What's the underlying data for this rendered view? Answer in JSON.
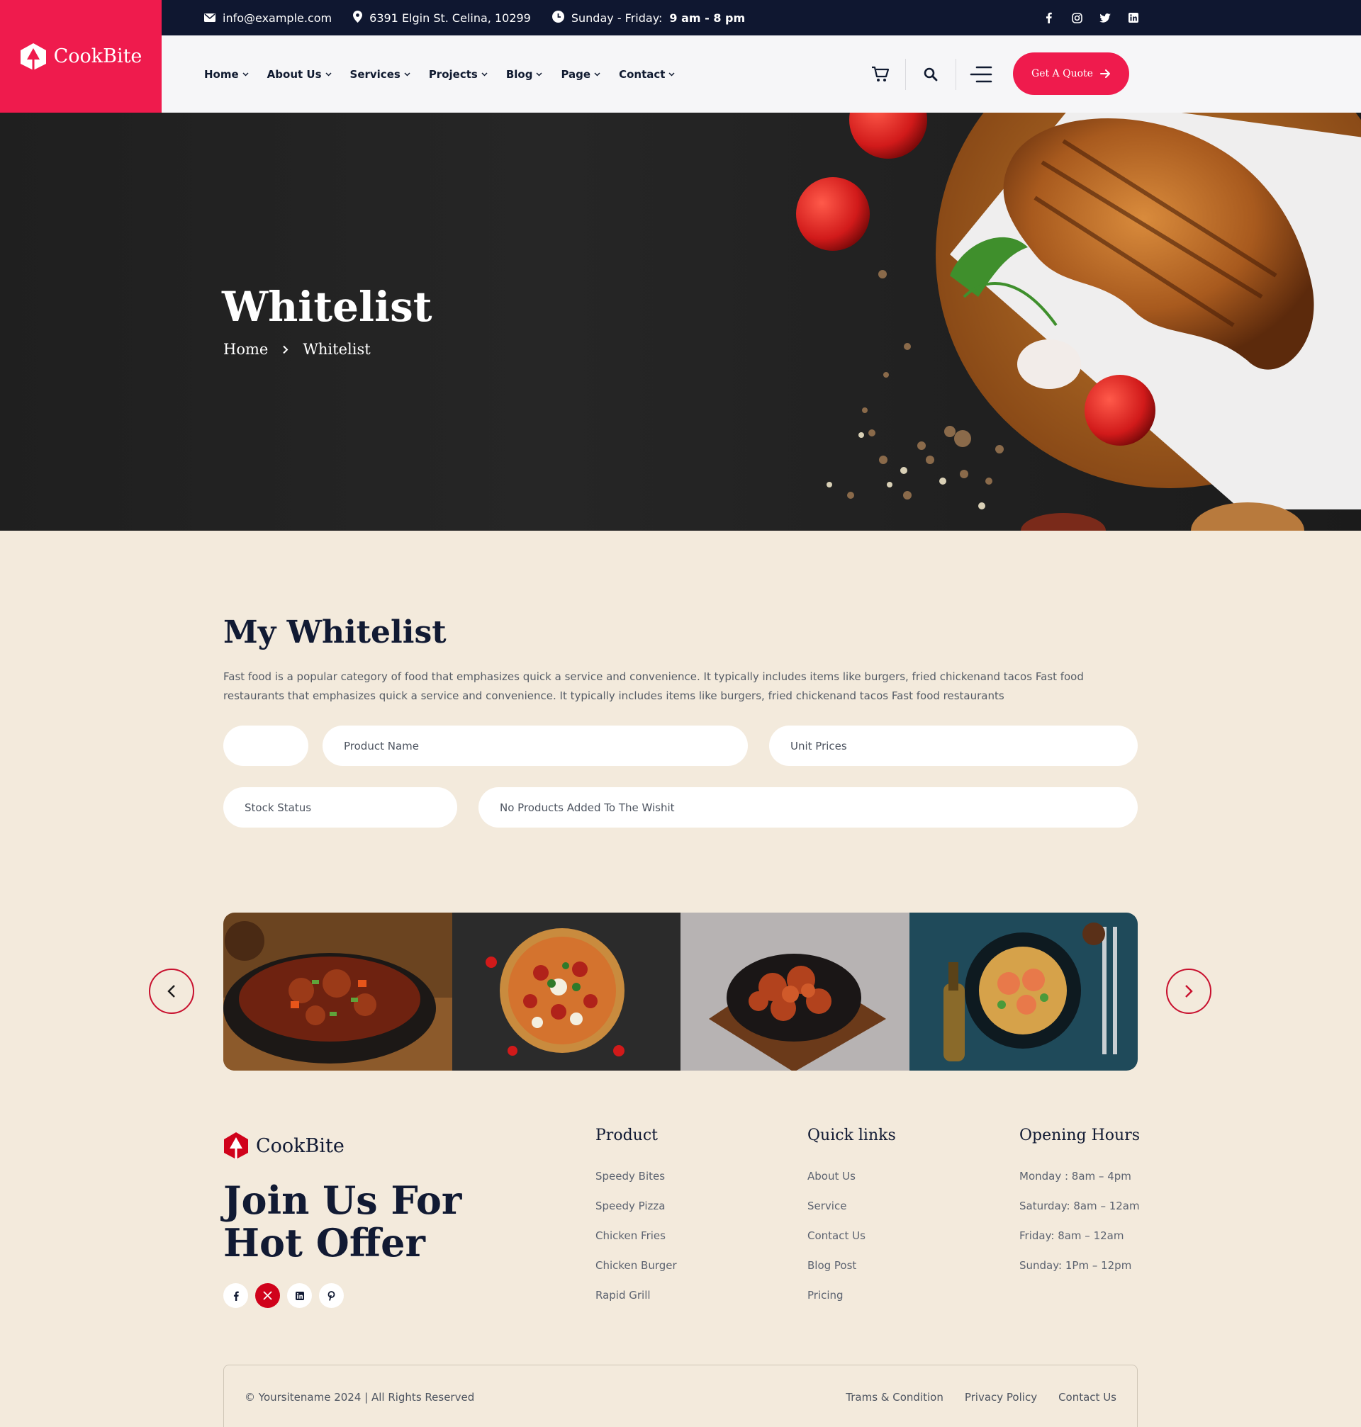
{
  "topbar": {
    "email": "info@example.com",
    "address": "6391 Elgin St. Celina, 10299",
    "hours_label": "Sunday - Friday:",
    "hours_value": "9 am - 8 pm",
    "social_icons": [
      "facebook-icon",
      "instagram-icon",
      "twitter-icon",
      "linkedin-icon"
    ]
  },
  "brand": {
    "name": "CookBite",
    "accent": "#ef1b4d",
    "dark": "#0f1730",
    "cream": "#f3eadc"
  },
  "nav": {
    "items": [
      {
        "label": "Home"
      },
      {
        "label": "About Us"
      },
      {
        "label": "Services"
      },
      {
        "label": "Projects"
      },
      {
        "label": "Blog"
      },
      {
        "label": "Page"
      },
      {
        "label": "Contact"
      }
    ],
    "quote_label": "Get A Quote"
  },
  "hero": {
    "title": "Whitelist",
    "breadcrumb": [
      "Home",
      "Whitelist"
    ]
  },
  "whitelist": {
    "title": "My Whitelist",
    "description": "Fast food is a popular category of food that emphasizes quick a service and convenience. It typically includes items like burgers, fried chickenand tacos Fast food restaurants that emphasizes quick a service and convenience. It typically includes items like burgers, fried chickenand tacos Fast food restaurants",
    "col_blank": "",
    "col_product": "Product Name",
    "col_price": "Unit Prices",
    "col_stock": "Stock Status",
    "empty_message": "No Products Added To The Wishit"
  },
  "footer": {
    "brand": "CookBite",
    "headline": "Join Us For Hot Offer",
    "social_icons": [
      "facebook-icon",
      "x-icon",
      "linkedin-icon",
      "pinterest-icon"
    ],
    "columns": [
      {
        "title": "Product",
        "items": [
          "Speedy Bites",
          "Speedy Pizza",
          "Chicken Fries",
          "Chicken Burger",
          "Rapid Grill"
        ]
      },
      {
        "title": "Quick links",
        "items": [
          "About Us",
          "Service",
          "Contact Us",
          "Blog Post",
          "Pricing"
        ]
      },
      {
        "title": "Opening Hours",
        "items": [
          "Monday : 8am – 4pm",
          "Saturday: 8am – 12am",
          "Friday: 8am – 12am",
          "Sunday: 1Pm – 12pm"
        ]
      }
    ],
    "copyright": "© Yoursitename  2024 | All Rights Reserved",
    "bottom_links": [
      "Trams & Condition",
      "Privacy Policy",
      "Contact Us"
    ]
  }
}
